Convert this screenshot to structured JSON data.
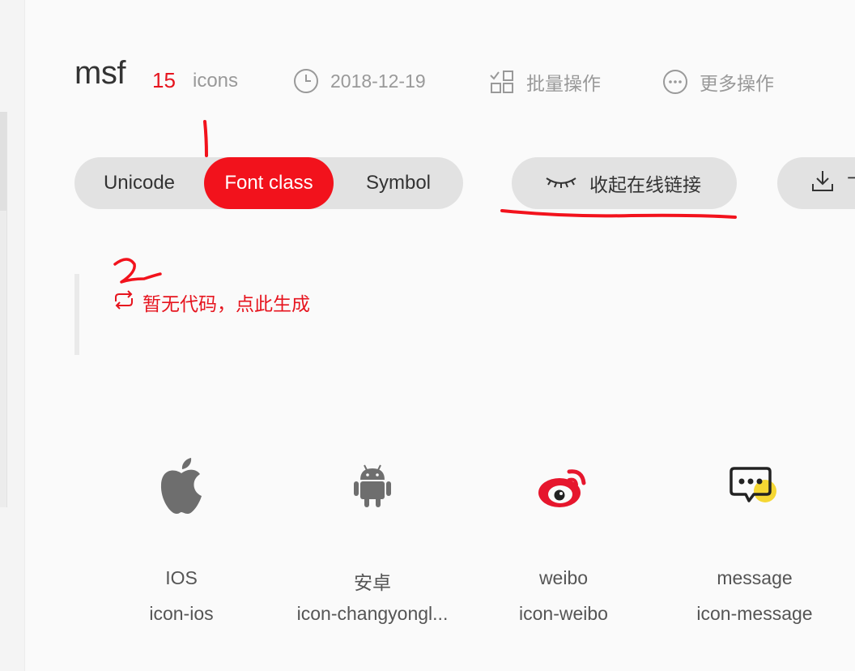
{
  "project": {
    "name": "msf",
    "icon_count": "15",
    "icons_word": "icons",
    "date": "2018-12-19",
    "batch_label": "批量操作",
    "more_label": "更多操作"
  },
  "tabs": {
    "unicode": "Unicode",
    "font_class": "Font class",
    "symbol": "Symbol"
  },
  "actions": {
    "collapse_link_label": "收起在线链接",
    "download_label": "下"
  },
  "code": {
    "generate_label": "暂无代码，点此生成"
  },
  "annotations": [
    "1",
    "2"
  ],
  "icons": [
    {
      "name": "IOS",
      "class": "icon-ios",
      "icon": "apple-icon"
    },
    {
      "name": "安卓",
      "class": "icon-changyongl...",
      "icon": "android-icon"
    },
    {
      "name": "weibo",
      "class": "icon-weibo",
      "icon": "weibo-icon"
    },
    {
      "name": "message",
      "class": "icon-message",
      "icon": "message-icon"
    }
  ],
  "colors": {
    "accent": "#f2121c",
    "pill_bg": "#e2e2e2",
    "muted": "#999999",
    "text": "#333333"
  }
}
